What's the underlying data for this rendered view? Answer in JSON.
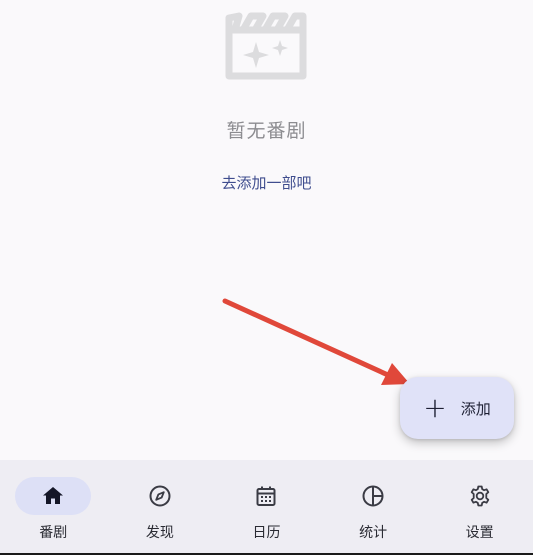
{
  "empty_state": {
    "icon": "movie-clapper-sparkle-icon",
    "title": "暂无番剧",
    "link": "去添加一部吧"
  },
  "fab": {
    "icon": "plus-icon",
    "label": "添加"
  },
  "bottom_nav": {
    "items": [
      {
        "label": "番剧",
        "icon": "home-icon",
        "active": true
      },
      {
        "label": "发现",
        "icon": "compass-icon",
        "active": false
      },
      {
        "label": "日历",
        "icon": "calendar-icon",
        "active": false
      },
      {
        "label": "统计",
        "icon": "pie-chart-icon",
        "active": false
      },
      {
        "label": "设置",
        "icon": "gear-icon",
        "active": false
      }
    ]
  },
  "colors": {
    "background": "#faf9fb",
    "accent_link": "#3f4d8e",
    "fab_background": "#e0e2f8",
    "nav_background": "#eeedf3",
    "nav_active_pill": "#dde0f6",
    "annotation_arrow": "#e0483a"
  }
}
